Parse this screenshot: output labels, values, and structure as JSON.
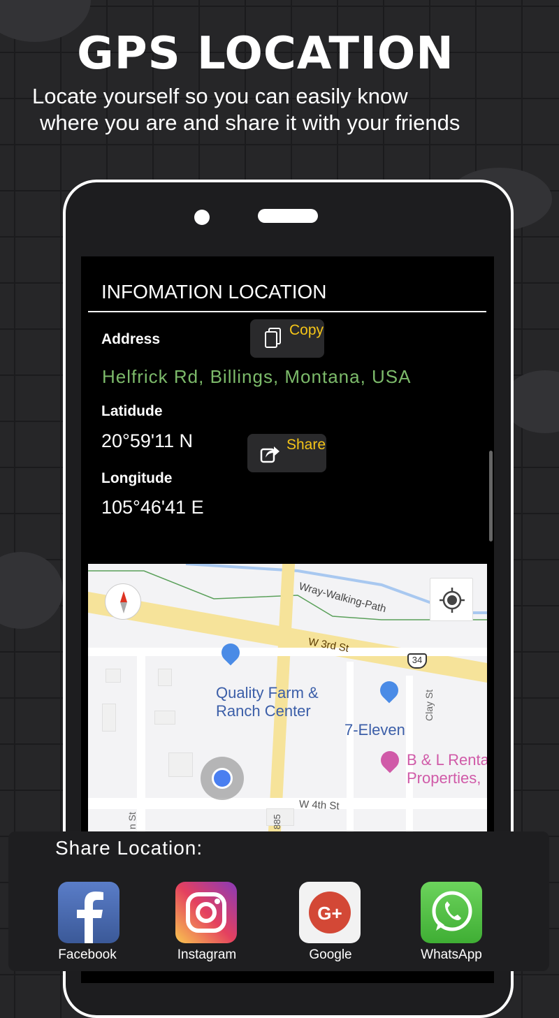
{
  "header": {
    "title": "GPS LOCATION",
    "subtitle_line1": "Locate yourself so you can easily know",
    "subtitle_line2": "where you are and share it with your friends"
  },
  "info": {
    "title": "INFOMATION LOCATION",
    "address_label": "Address",
    "address_value": "Helfrick Rd, Billings, Montana, USA",
    "latitude_label": "Latidude",
    "latitude_value": "20°59'11 N",
    "longitude_label": "Longitude",
    "longitude_value": "105°46'41 E",
    "copy_label": "Copy",
    "share_label": "Share"
  },
  "map": {
    "labels": {
      "path": "Wray-Walking-Path",
      "street1": "W 3rd St",
      "street2": "W 4th St",
      "street3": "Clay St",
      "street4": "n St",
      "route": "34",
      "road_num": "885",
      "poi1": "Quality Farm &",
      "poi1b": "Ranch Center",
      "poi2": "7-Eleven",
      "poi3": "B & L Renta",
      "poi3b": "Properties,"
    }
  },
  "share": {
    "title": "Share Location:",
    "apps": [
      {
        "label": "Facebook",
        "icon": "facebook-icon",
        "color": "#3b5998"
      },
      {
        "label": "Instagram",
        "icon": "instagram-icon",
        "color": "#c13584"
      },
      {
        "label": "Google",
        "icon": "google-plus-icon",
        "color": "#d34836"
      },
      {
        "label": "WhatsApp",
        "icon": "whatsapp-icon",
        "color": "#4cba3c"
      }
    ]
  },
  "colors": {
    "accent": "#f5c518",
    "address": "#7cba6a",
    "background": "#262628"
  }
}
